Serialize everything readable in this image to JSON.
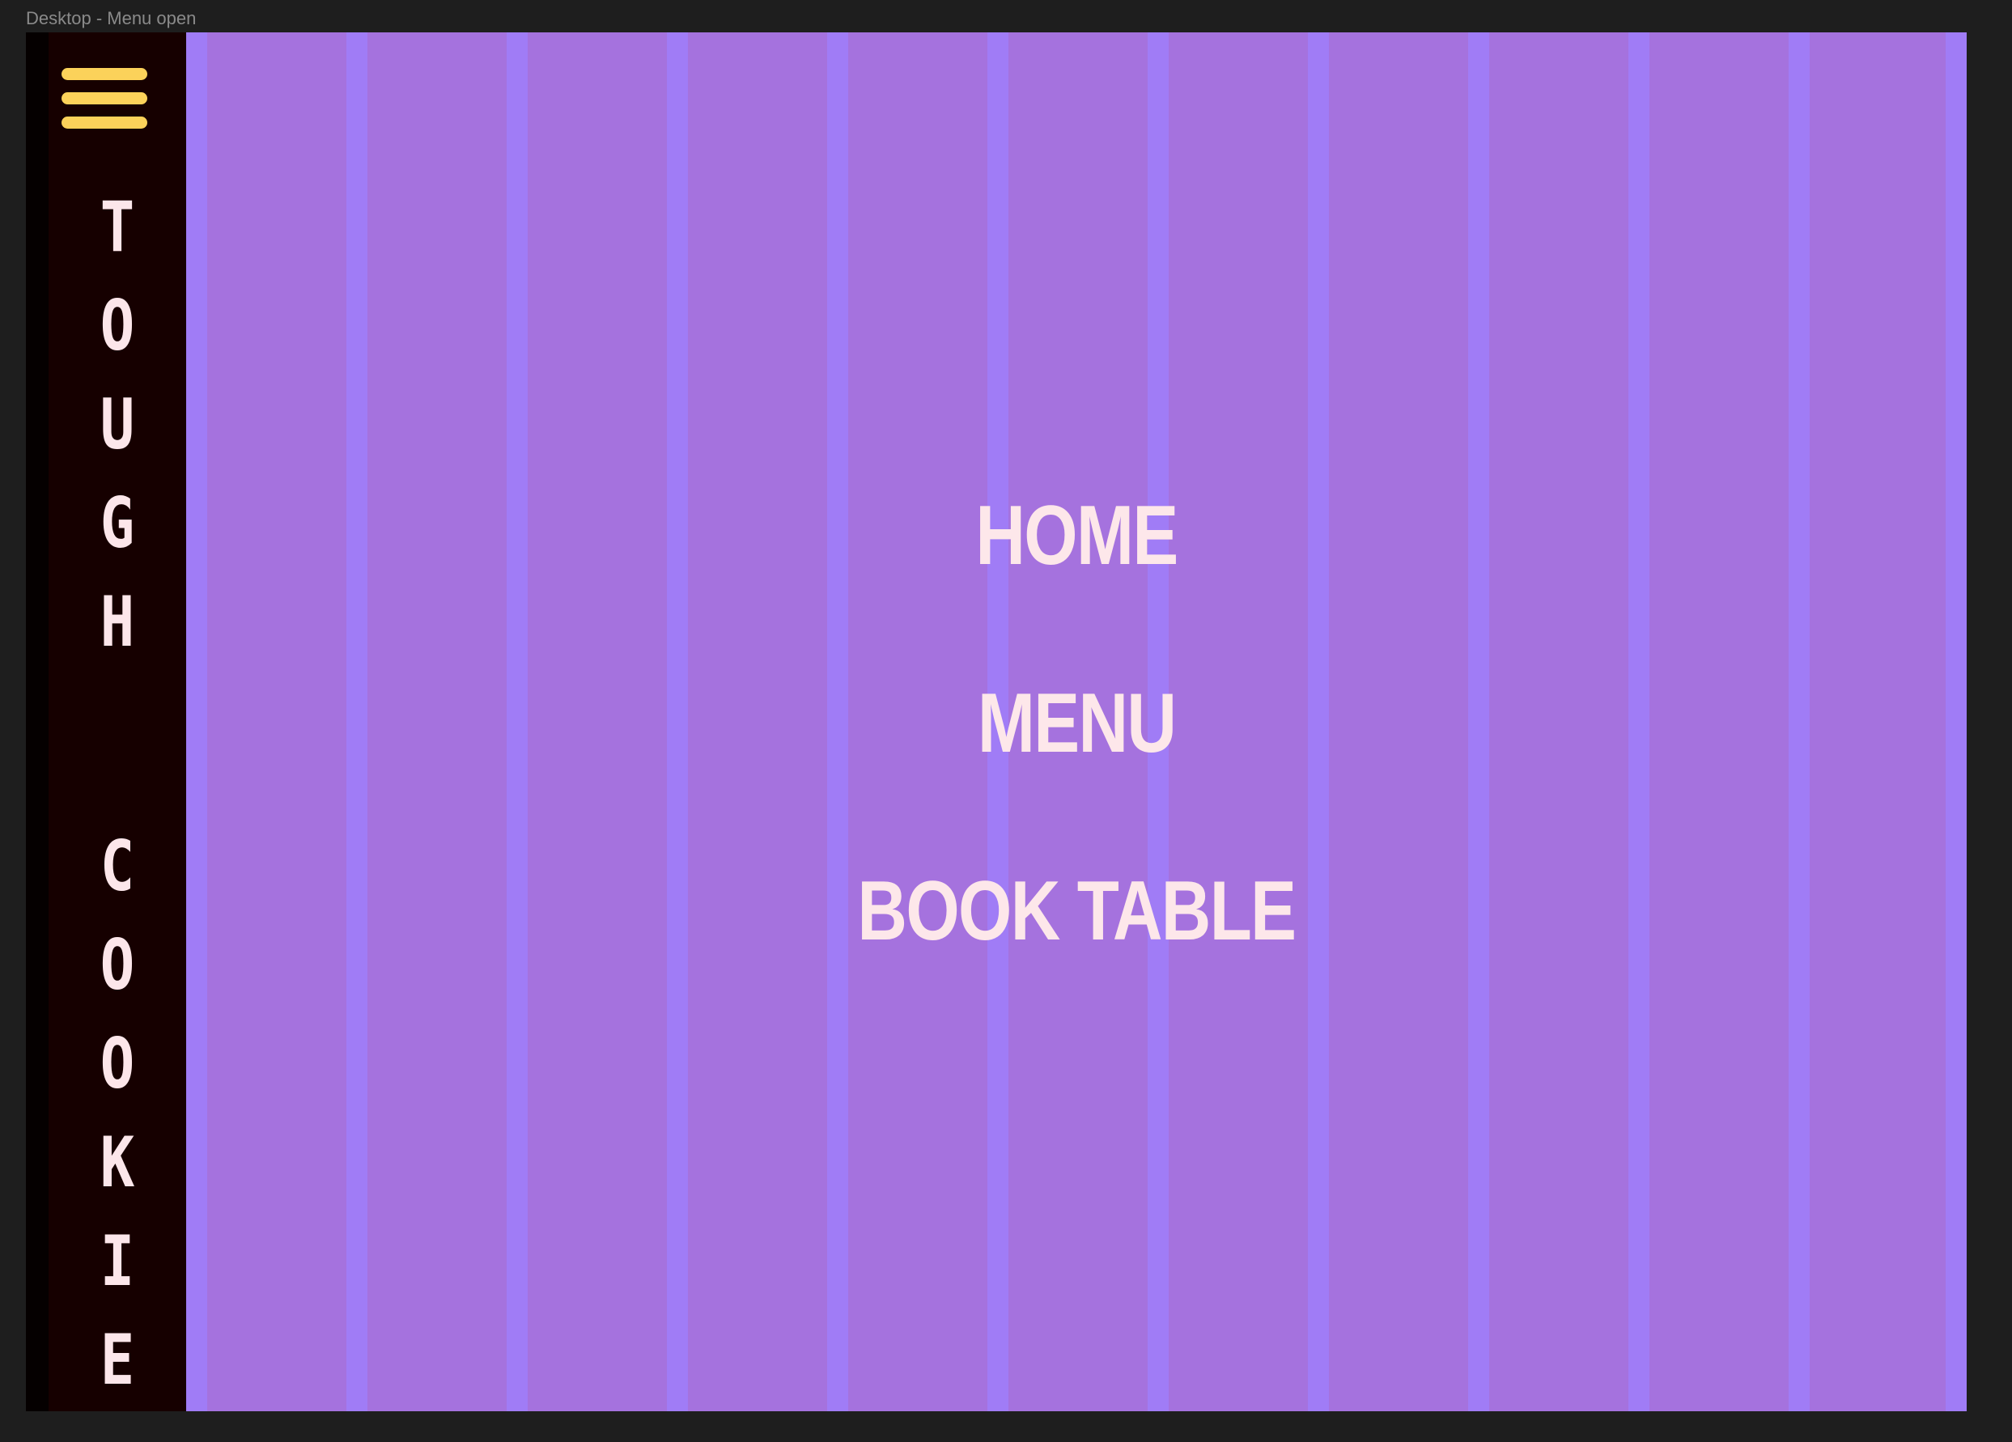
{
  "frame": {
    "label": "Desktop - Menu open"
  },
  "colors": {
    "canvas": "#1e1e1e",
    "background": "#a572de",
    "grid_column": "#a07cf6",
    "sidebar": "#160000",
    "hamburger": "#fbd25a",
    "text": "#fde7ea"
  },
  "sidebar": {
    "menu_icon": "hamburger-icon",
    "brand_letters_1": [
      "T",
      "O",
      "U",
      "G",
      "H"
    ],
    "brand_letters_2": [
      "C",
      "O",
      "O",
      "K",
      "I",
      "E"
    ]
  },
  "nav": {
    "items": [
      {
        "label": "HOME"
      },
      {
        "label": "MENU"
      },
      {
        "label": "BOOK TABLE"
      }
    ]
  }
}
